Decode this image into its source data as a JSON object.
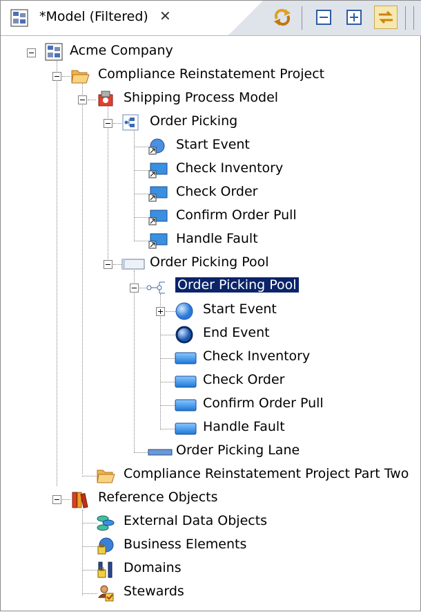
{
  "tab": {
    "title": "*Model (Filtered)",
    "close_glyph": "✕"
  },
  "toolbar": {
    "sync_icon": "sync-icon",
    "collapse_icon": "collapse-all-icon",
    "expand_icon": "expand-all-icon",
    "link_icon": "link-with-editor-icon"
  },
  "tree": {
    "acme": "Acme Company",
    "project1": "Compliance Reinstatement  Project",
    "shipping": "Shipping Process Model",
    "order_picking": "Order Picking",
    "op_items": [
      "Start Event",
      "Check Inventory",
      "Check Order",
      "Confirm Order Pull",
      "Handle Fault"
    ],
    "pool": "Order Picking Pool",
    "pool_process": "Order Picking Pool",
    "pool_items": [
      "Start Event",
      "End Event",
      "Check Inventory",
      "Check Order",
      "Confirm Order Pull",
      "Handle Fault"
    ],
    "lane": "Order Picking Lane",
    "project2": "Compliance Reinstatement Project Part Two",
    "reference": "Reference Objects",
    "ref_items": [
      "External Data Objects",
      "Business Elements",
      "Domains",
      "Stewards"
    ]
  },
  "colors": {
    "selection": "#0a246a",
    "tab_bg": "#dfe3ea"
  }
}
